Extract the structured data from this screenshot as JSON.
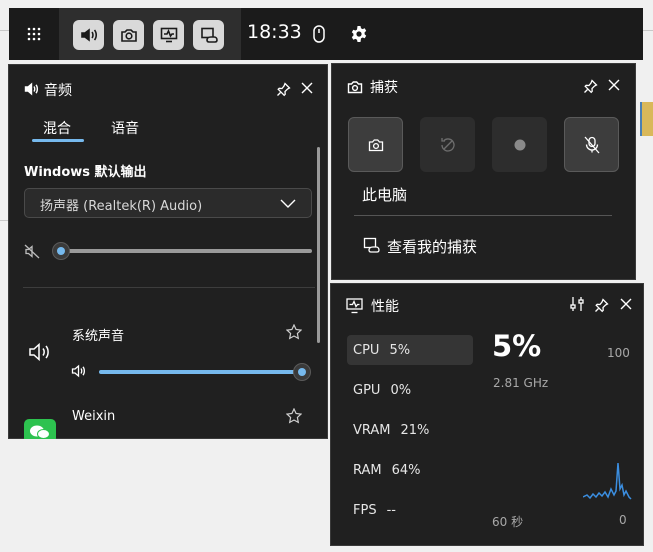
{
  "gamebar": {
    "time": "18:33",
    "widgets": [
      "audio-widget",
      "capture-widget",
      "performance-widget",
      "xbox-social-widget"
    ]
  },
  "audio": {
    "title": "音频",
    "tabs": [
      {
        "label": "混合",
        "active": true
      },
      {
        "label": "语音",
        "active": false
      }
    ],
    "output_label": "Windows 默认输出",
    "device": "扬声器 (Realtek(R) Audio)",
    "master_volume": 0,
    "master_muted": true,
    "apps": [
      {
        "name": "系统声音",
        "volume": 100
      },
      {
        "name": "Weixin"
      }
    ]
  },
  "capture": {
    "title": "捕获",
    "source": "此电脑",
    "view_link": "查看我的捕获"
  },
  "performance": {
    "title": "性能",
    "metrics": [
      {
        "name": "CPU",
        "value": "5%"
      },
      {
        "name": "GPU",
        "value": "0%"
      },
      {
        "name": "VRAM",
        "value": "21%"
      },
      {
        "name": "RAM",
        "value": "64%"
      },
      {
        "name": "FPS",
        "value": "--"
      }
    ],
    "big_value": "5%",
    "frequency": "2.81 GHz",
    "y_max": "100",
    "y_min": "0",
    "x_label": "60 秒",
    "accent": "#3b8ee0"
  }
}
